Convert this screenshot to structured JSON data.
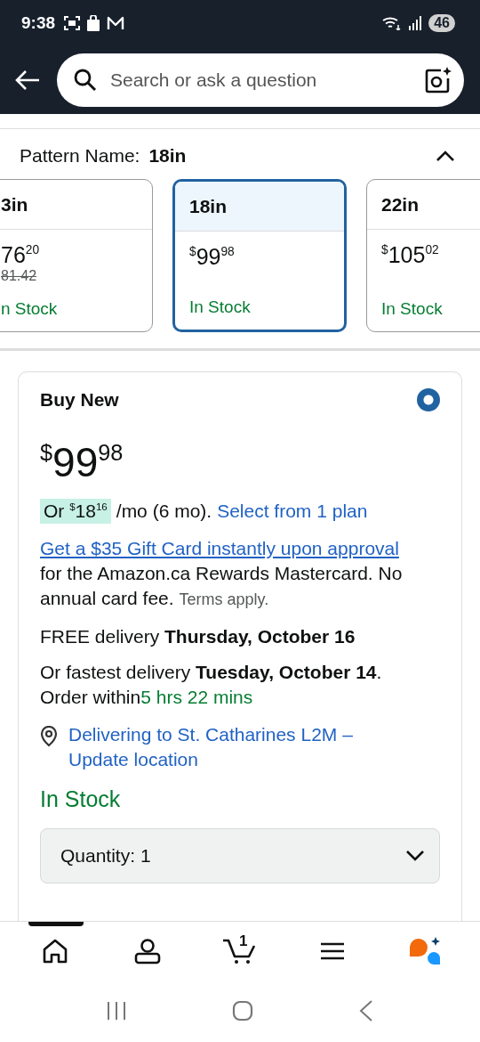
{
  "status_bar": {
    "time": "9:38",
    "battery": "46"
  },
  "search": {
    "placeholder": "Search or ask a question"
  },
  "pattern": {
    "label": "Pattern Name:",
    "value": "18in",
    "expanded": true,
    "options": [
      {
        "name": "3in",
        "whole": "76",
        "fraction": "20",
        "list_price": "81.42",
        "availability": "n Stock",
        "selected": false
      },
      {
        "name": "18in",
        "currency": "$",
        "whole": "99",
        "fraction": "98",
        "availability": "In Stock",
        "selected": true
      },
      {
        "name": "22in",
        "currency": "$",
        "whole": "105",
        "fraction": "02",
        "availability": "In Stock",
        "selected": false
      }
    ]
  },
  "buy_box": {
    "title": "Buy New",
    "selected": true,
    "price": {
      "currency": "$",
      "whole": "99",
      "fraction": "98"
    },
    "installment": {
      "prefix": "Or",
      "currency": "$",
      "whole": "18",
      "fraction": "16",
      "suffix": "/mo (6 mo).",
      "link": "Select from 1 plan"
    },
    "promo": {
      "link": "Get a $35 Gift Card instantly upon approval",
      "text": "for the Amazon.ca Rewards Mastercard. No annual card fee.",
      "terms": "Terms apply."
    },
    "delivery": "FREE delivery **Thursday, October 16**",
    "fastest": "Or fastest delivery **Tuesday, October 14**.",
    "order_within": {
      "label": "Order within",
      "time": "5 hrs 22 mins"
    },
    "location": "Delivering to St. Catharines L2M – Update location",
    "availability": "In Stock",
    "quantity": "Quantity: 1"
  },
  "bottom_nav": [
    {
      "kind": "home",
      "selected": true
    },
    {
      "kind": "account",
      "selected": false
    },
    {
      "kind": "cart",
      "badge": "1",
      "selected": false
    },
    {
      "kind": "menu",
      "selected": false
    },
    {
      "kind": "assistant",
      "selected": false
    }
  ]
}
